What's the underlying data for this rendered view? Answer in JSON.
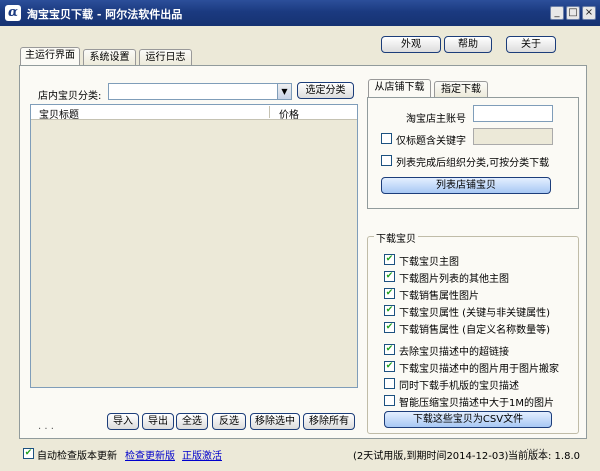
{
  "window": {
    "title": "淘宝宝贝下载 - 阿尔法软件出品",
    "minimize_glyph": "_",
    "maximize_glyph": "□",
    "close_glyph": "×",
    "app_icon_glyph": "α"
  },
  "header_buttons": {
    "appearance": "外观",
    "help": "帮助",
    "about": "关于"
  },
  "tabs": [
    "主运行界面",
    "系统设置",
    "运行日志"
  ],
  "category": {
    "label": "店内宝贝分类:",
    "value": "",
    "select_button": "选定分类"
  },
  "list": {
    "columns": [
      "宝贝标题",
      "价格"
    ],
    "rows": [],
    "status": ". . ."
  },
  "list_buttons": [
    "导入",
    "导出",
    "全选",
    "反选",
    "移除选中",
    "移除所有"
  ],
  "shop_tabs": [
    "从店铺下载",
    "指定下载"
  ],
  "shop": {
    "account_label": "淘宝店主账号",
    "account_value": "",
    "keyword_label": "仅标题含关键字",
    "keyword_value": "",
    "group_label": "列表完成后组织分类,可按分类下载",
    "list_button": "列表店铺宝贝"
  },
  "download": {
    "group_title": "下载宝贝",
    "options": [
      {
        "label": "下载宝贝主图",
        "checked": true
      },
      {
        "label": "下载图片列表的其他主图",
        "checked": true
      },
      {
        "label": "下载销售属性图片",
        "checked": true
      },
      {
        "label": "下载宝贝属性 (关键与非关键属性)",
        "checked": true
      },
      {
        "label": "下载销售属性 (自定义名称数量等)",
        "checked": true
      },
      {
        "label": "去除宝贝描述中的超链接",
        "checked": true
      },
      {
        "label": "下载宝贝描述中的图片用于图片搬家",
        "checked": true
      },
      {
        "label": "同时下载手机版的宝贝描述",
        "checked": false
      },
      {
        "label": "智能压缩宝贝描述中大于1M的图片",
        "checked": false
      }
    ],
    "csv_button": "下载这些宝贝为CSV文件",
    "dots": "......"
  },
  "footer": {
    "auto_update_label": "自动检查版本更新",
    "auto_update_checked": true,
    "check_update_link": "检查更新版",
    "genuine_link": "正版激活",
    "trial_text": "(2天试用版,到期时间2014-12-03)",
    "version_text": "当前版本: 1.8.0"
  },
  "colors": {
    "titlebar": "#1b3a80",
    "check": "#21a121",
    "link": "#0000cc"
  }
}
